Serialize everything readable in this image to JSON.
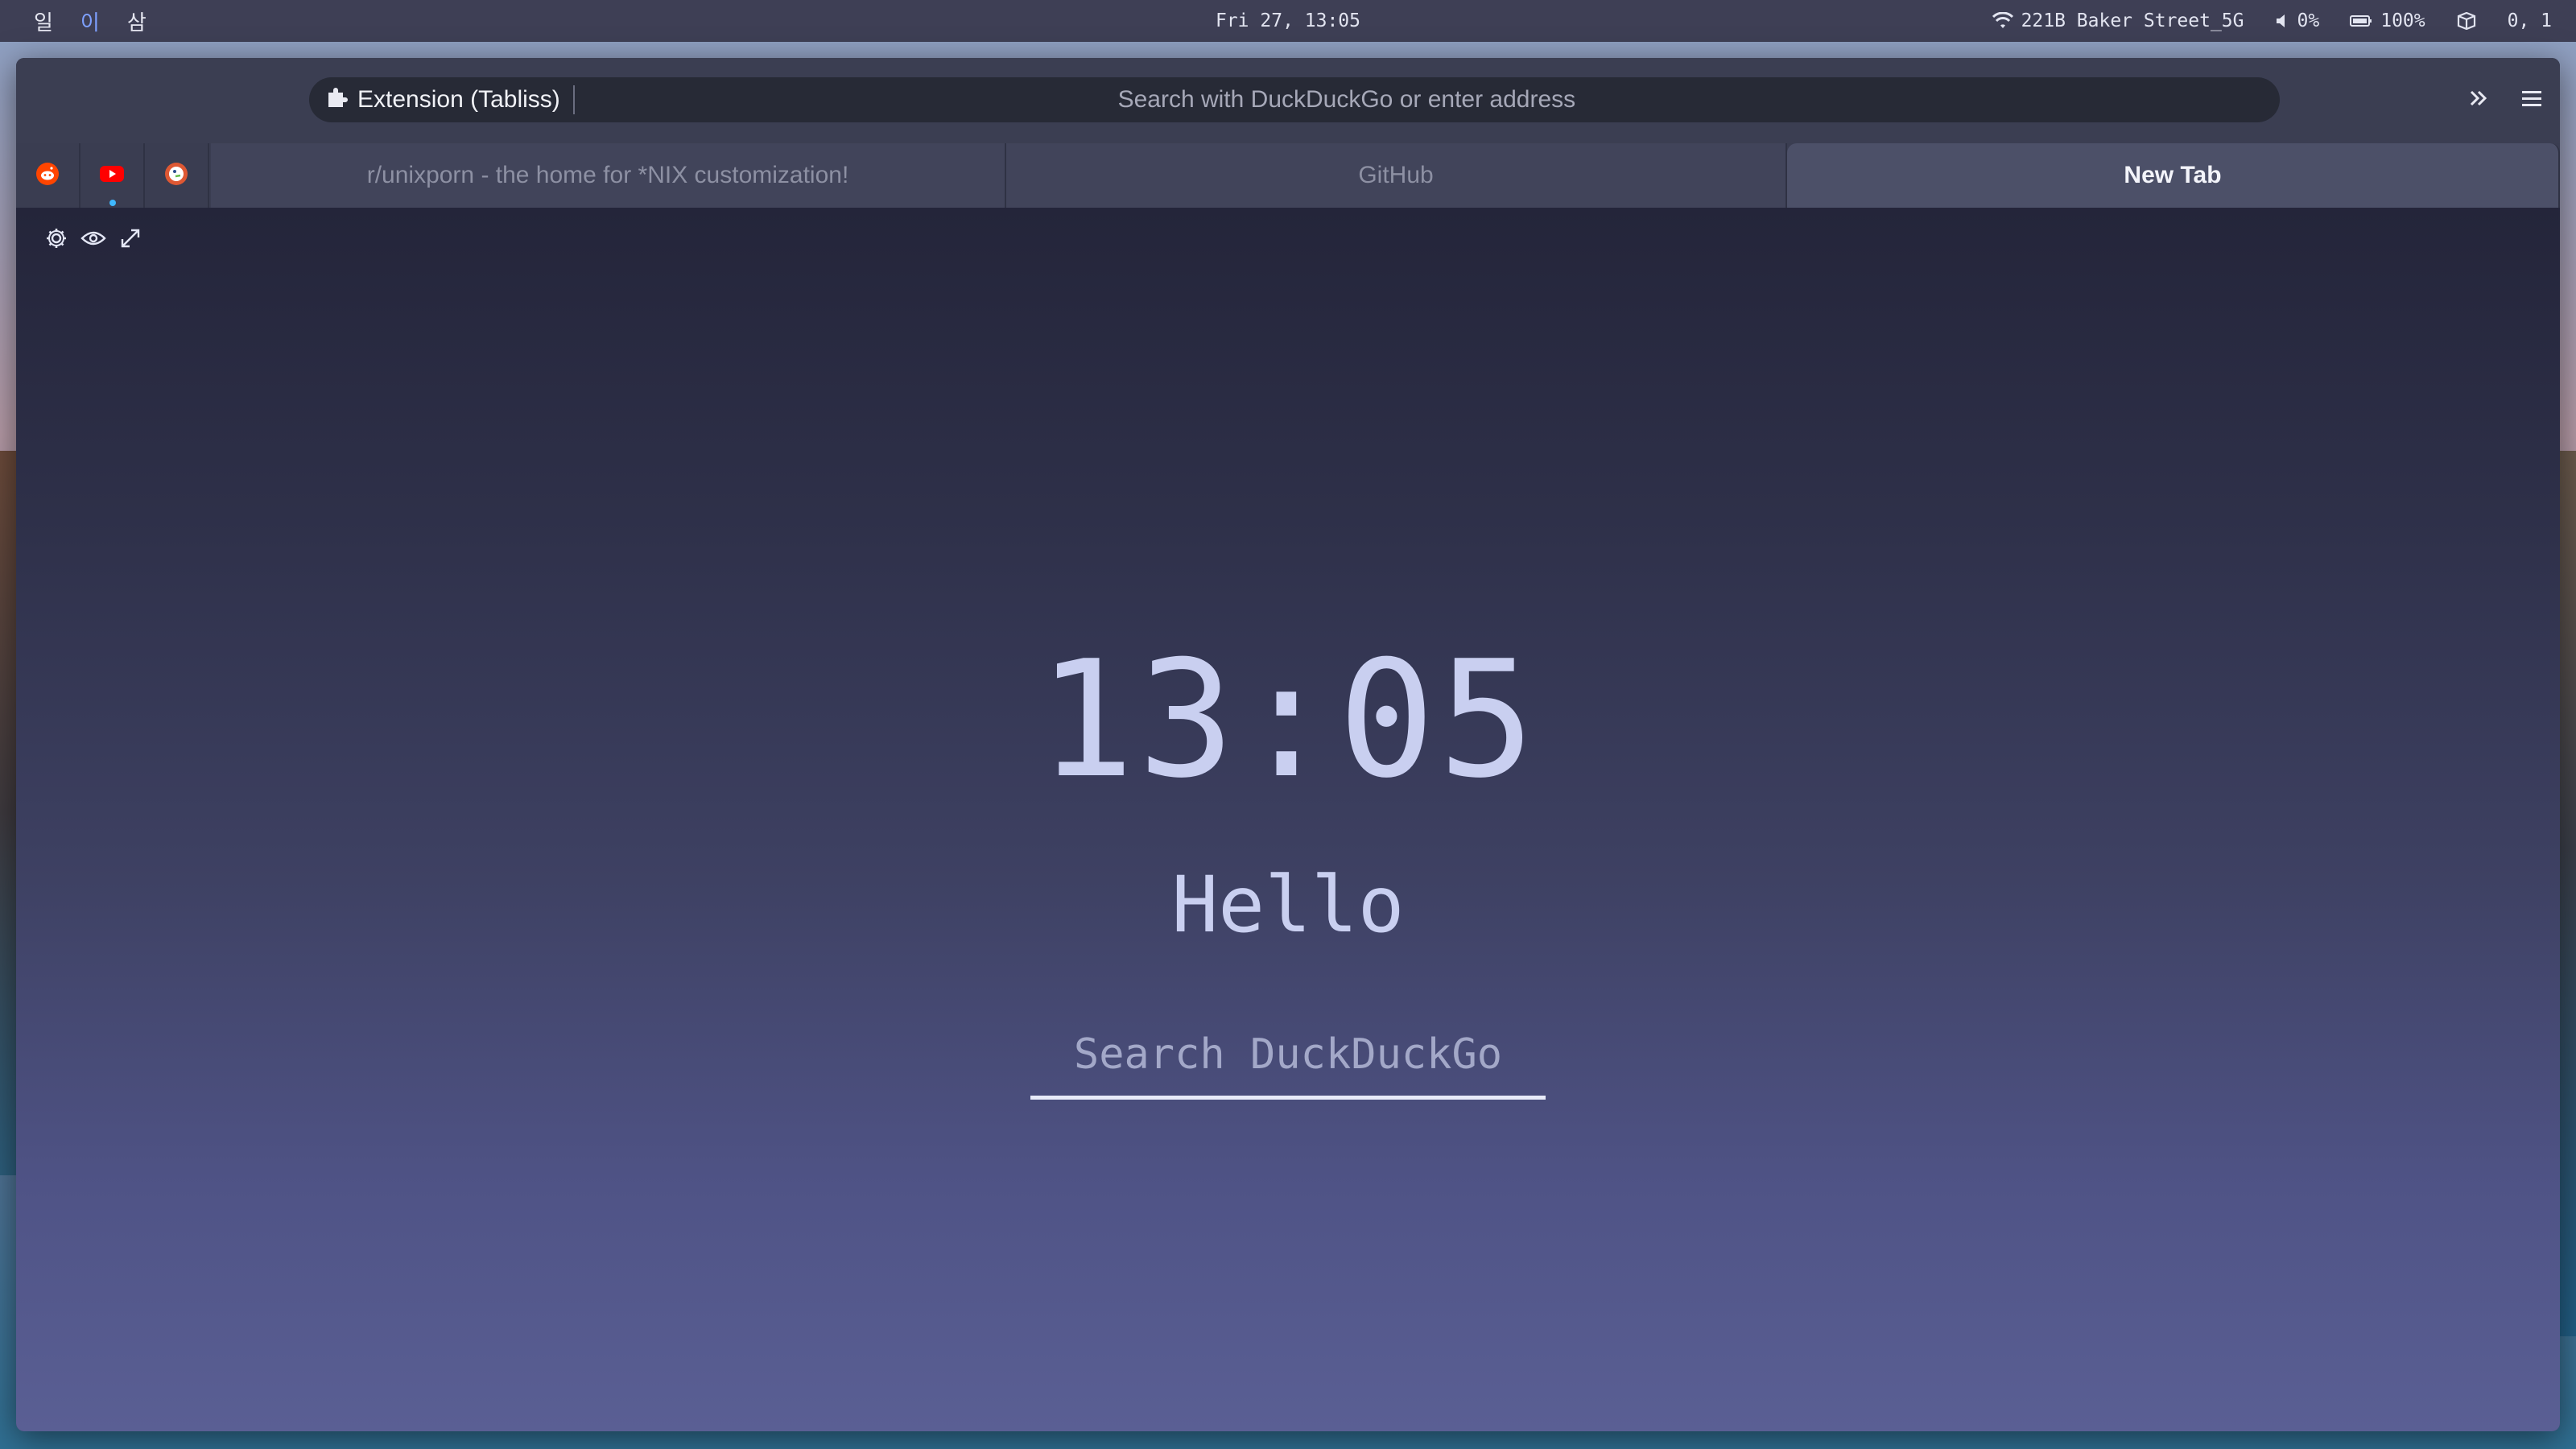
{
  "topbar": {
    "workspaces": [
      {
        "label": "일",
        "active": false
      },
      {
        "label": "이",
        "active": true
      },
      {
        "label": "삼",
        "active": false
      }
    ],
    "datetime": "Fri 27, 13:05",
    "wifi_name": "221B Baker Street_5G",
    "volume": "0%",
    "battery": "100%",
    "layout_status": "0, 1",
    "icons": [
      "wifi-icon",
      "speaker-icon",
      "battery-icon",
      "package-icon"
    ]
  },
  "browser": {
    "url_chip_label": "Extension (Tabliss)",
    "url_placeholder": "Search with DuckDuckGo or enter address",
    "pinned_tabs": [
      "reddit-icon",
      "youtube-icon",
      "duckduckgo-icon"
    ],
    "tabs": [
      {
        "label": "r/unixporn - the home for *NIX customization!",
        "active": false
      },
      {
        "label": "GitHub",
        "active": false
      },
      {
        "label": "New Tab",
        "active": true
      }
    ]
  },
  "newtab": {
    "time": "13:05",
    "greeting": "Hello",
    "search_placeholder": "Search DuckDuckGo"
  },
  "colors": {
    "accent_workspace": "#7ea0ff",
    "reddit": "#ff4500",
    "youtube": "#ff0000",
    "duckduckgo": "#de5833"
  }
}
